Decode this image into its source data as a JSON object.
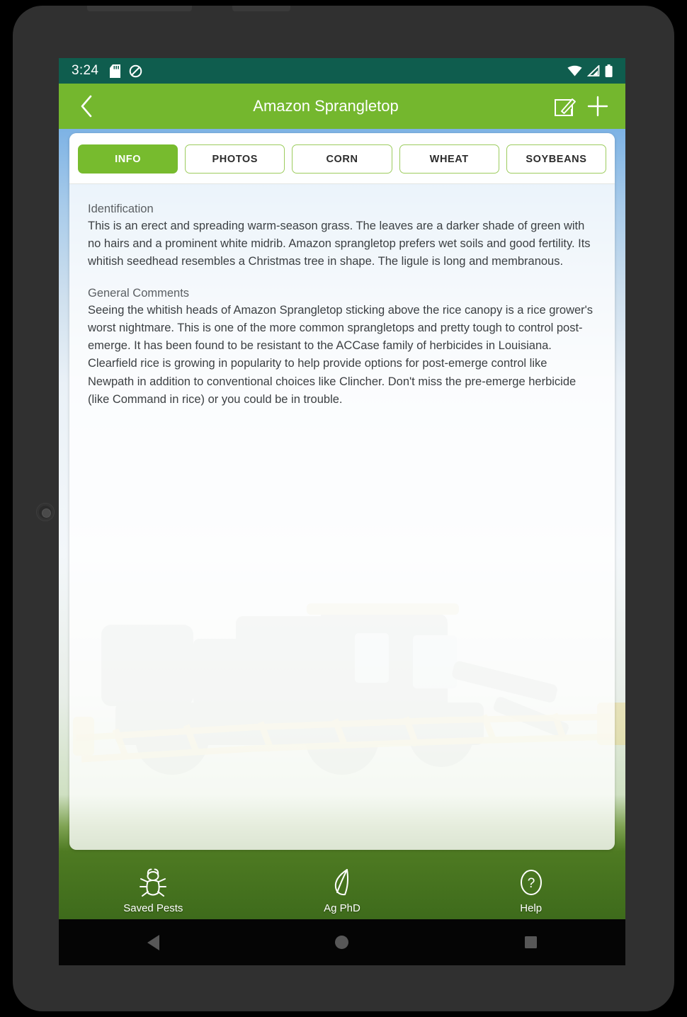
{
  "status_bar": {
    "time": "3:24",
    "left_icons": [
      "sd-card-icon",
      "do-not-disturb-icon"
    ],
    "right_icons": [
      "wifi-icon",
      "cell-signal-icon",
      "battery-icon"
    ],
    "background_color": "#0f5d4e"
  },
  "app_bar": {
    "title": "Amazon Sprangletop",
    "back_label": "Back",
    "edit_label": "Edit",
    "add_label": "Add",
    "background_color": "#74b72e"
  },
  "tabs": [
    {
      "label": "INFO",
      "active": true
    },
    {
      "label": "PHOTOS",
      "active": false
    },
    {
      "label": "CORN",
      "active": false
    },
    {
      "label": "WHEAT",
      "active": false
    },
    {
      "label": "SOYBEANS",
      "active": false
    }
  ],
  "content": {
    "sections": [
      {
        "heading": "Identification",
        "body": "This is an erect and spreading warm-season grass.  The leaves are a darker shade of green with no hairs and a prominent white midrib.  Amazon sprangletop prefers wet soils and good fertility.  Its whitish seedhead resembles a Christmas tree in shape. The ligule is long and membranous."
      },
      {
        "heading": "General Comments",
        "body": "Seeing the whitish heads of Amazon Sprangletop sticking above the rice canopy is a rice grower's worst nightmare.  This is one of the more common sprangletops and pretty tough to control post-emerge.  It has been found to be resistant to the ACCase family of herbicides in Louisiana.  Clearfield rice is growing in popularity to help provide options for post-emerge control like Newpath in addition to conventional choices like Clincher.  Don't miss the pre-emerge herbicide (like Command in rice) or you could be in trouble."
      }
    ]
  },
  "bottom_nav": [
    {
      "label": "Saved Pests",
      "icon": "bug-icon"
    },
    {
      "label": "Ag PhD",
      "icon": "leaf-icon"
    },
    {
      "label": "Help",
      "icon": "question-circle-icon"
    }
  ],
  "android_nav": {
    "back": "Back",
    "home": "Home",
    "recents": "Recent apps"
  }
}
